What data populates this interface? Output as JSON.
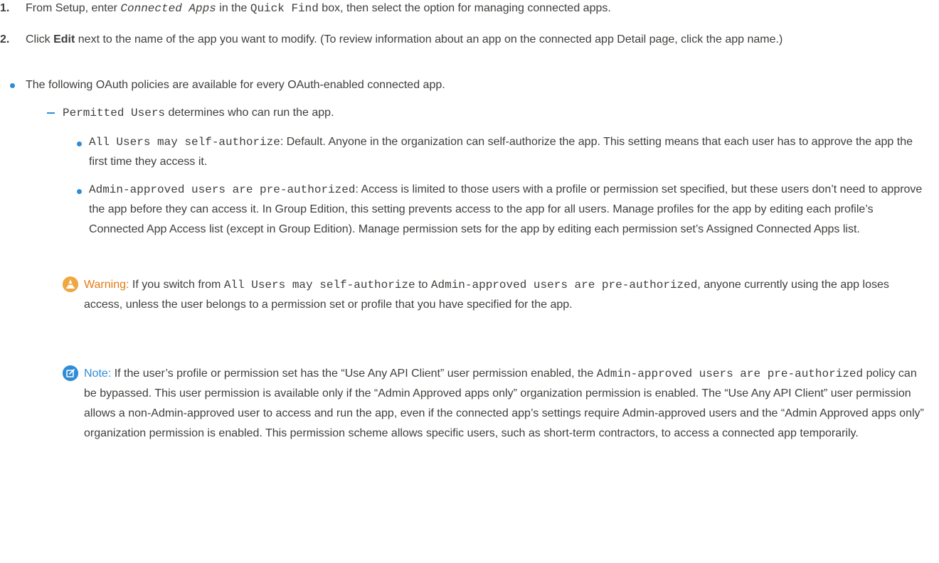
{
  "steps": [
    {
      "number": "1.",
      "parts": [
        {
          "t": "From Setup, enter "
        },
        {
          "t": "Connected Apps",
          "code": true,
          "italic": true
        },
        {
          "t": " in the "
        },
        {
          "t": "Quick Find",
          "code": true
        },
        {
          "t": " box, then select the option for managing connected apps."
        }
      ]
    },
    {
      "number": "2.",
      "parts": [
        {
          "t": "Click "
        },
        {
          "t": "Edit",
          "bold": true
        },
        {
          "t": " next to the name of the app you want to modify. (To review information about an app on the connected app Detail page, click the app name.)"
        }
      ]
    }
  ],
  "policies_intro": "The following OAuth policies are available for every OAuth-enabled connected app.",
  "permitted_users": {
    "term": "Permitted Users",
    "text": " determines who can run the app."
  },
  "options": [
    {
      "term": "All Users may self-authorize",
      "text": ": Default. Anyone in the organization can self-authorize the app. This setting means that each user has to approve the app the first time they access it."
    },
    {
      "term": "Admin-approved users are pre-authorized",
      "text": ": Access is limited to those users with a profile or permission set specified, but these users don’t need to approve the app before they can access it. In Group Edition, this setting prevents access to the app for all users. Manage profiles for the app by editing each profile’s Connected App Access list (except in Group Edition). Manage permission sets for the app by editing each permission set’s Assigned Connected Apps list."
    }
  ],
  "warning": {
    "label": "Warning:",
    "parts": [
      {
        "t": " If you switch from "
      },
      {
        "t": "All Users may self-authorize",
        "code": true
      },
      {
        "t": " to "
      },
      {
        "t": "Admin-approved users are pre-authorized",
        "code": true
      },
      {
        "t": ", anyone currently using the app loses access, unless the user belongs to a permission set or profile that you have specified for the app."
      }
    ]
  },
  "note": {
    "label": "Note:",
    "parts": [
      {
        "t": " If the user’s profile or permission set has the “Use Any API Client” user permission enabled, the "
      },
      {
        "t": "Admin-approved users are pre-authorized",
        "code": true
      },
      {
        "t": " policy can be bypassed. This user permission is available only if the “Admin Approved apps only” organization permission is enabled. The “Use Any API Client” user permission allows a non-Admin-approved user to access and run the app, even if the connected app’s settings require Admin-approved users and the “Admin Approved apps only” organization permission is enabled. This permission scheme allows specific users, such as short-term contractors, to access a connected app temporarily."
      }
    ]
  },
  "colors": {
    "text": "#3e3e3c",
    "bullet": "#2f8cd6",
    "warning": "#e47a16",
    "note": "#2f8cd6"
  },
  "icons": {
    "warning": "warning-cone-icon",
    "note": "note-edit-icon"
  }
}
